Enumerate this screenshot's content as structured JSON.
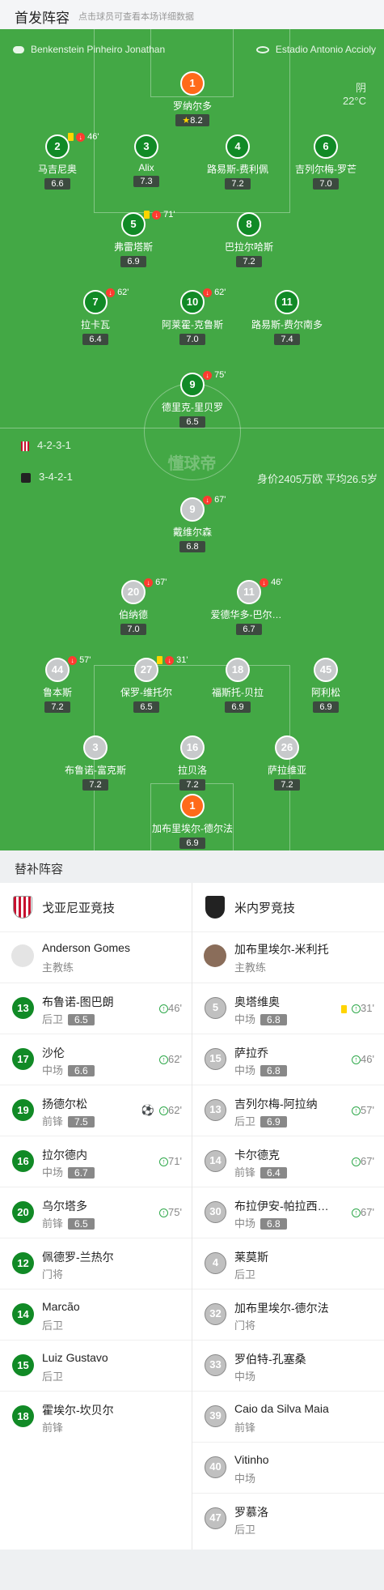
{
  "header": {
    "title": "首发阵容",
    "hint": "点击球员可查看本场详细数据"
  },
  "match": {
    "referee": "Benkenstein Pinheiro Jonathan",
    "stadium": "Estadio Antonio Accioly",
    "weather": "阴",
    "temperature": "22°C",
    "watermark": "懂球帝"
  },
  "home": {
    "team": "戈亚尼亚竞技",
    "formation": "4-2-3-1",
    "coach": "Anderson Gomes",
    "coach_role": "主教练",
    "starters": {
      "gk": {
        "num": "1",
        "name": "罗纳尔多",
        "rating": "8.2"
      },
      "d1": {
        "num": "2",
        "name": "马吉尼奥",
        "rating": "6.6",
        "event": "46'"
      },
      "d2": {
        "num": "3",
        "name": "Alix",
        "rating": "7.3"
      },
      "d3": {
        "num": "4",
        "name": "路易斯-费利佩",
        "rating": "7.2"
      },
      "d4": {
        "num": "6",
        "name": "吉列尔梅-罗芒",
        "rating": "7.0"
      },
      "m1": {
        "num": "5",
        "name": "弗雷塔斯",
        "rating": "6.9",
        "event": "71'"
      },
      "m2": {
        "num": "8",
        "name": "巴拉尔哈斯",
        "rating": "7.2"
      },
      "am1": {
        "num": "7",
        "name": "拉卡瓦",
        "rating": "6.4",
        "event": "62'"
      },
      "am2": {
        "num": "10",
        "name": "阿莱霍-克鲁斯",
        "rating": "7.0",
        "event": "62'"
      },
      "am3": {
        "num": "11",
        "name": "路易斯-费尔南多",
        "rating": "7.4"
      },
      "st": {
        "num": "9",
        "name": "德里克-里贝罗",
        "rating": "6.5",
        "event": "75'"
      }
    }
  },
  "away": {
    "team": "米内罗竞技",
    "formation": "3-4-2-1",
    "market_value": "身价2405万欧 平均26.5岁",
    "coach": "加布里埃尔-米利托",
    "coach_role": "主教练",
    "starters": {
      "st": {
        "num": "9",
        "name": "戴维尔森",
        "rating": "6.8",
        "event": "67'"
      },
      "am1": {
        "num": "20",
        "name": "伯纳德",
        "rating": "7.0",
        "event": "67'"
      },
      "am2": {
        "num": "11",
        "name": "爱德华多-巴尔加斯",
        "rating": "6.7",
        "event": "46'"
      },
      "m1": {
        "num": "44",
        "name": "鲁本斯",
        "rating": "7.2",
        "event": "57'"
      },
      "m2": {
        "num": "27",
        "name": "保罗-维托尔",
        "rating": "6.5",
        "event": "31'"
      },
      "m3": {
        "num": "18",
        "name": "福斯托-贝拉",
        "rating": "6.9"
      },
      "m4": {
        "num": "45",
        "name": "阿利松",
        "rating": "6.9"
      },
      "d1": {
        "num": "3",
        "name": "布鲁诺-富克斯",
        "rating": "7.2"
      },
      "d2": {
        "num": "16",
        "name": "拉贝洛",
        "rating": "7.2"
      },
      "d3": {
        "num": "26",
        "name": "萨拉维亚",
        "rating": "7.2"
      },
      "gk": {
        "num": "1",
        "name": "加布里埃尔-德尔法",
        "rating": "6.9"
      }
    }
  },
  "subs_title": "替补阵容",
  "home_subs": [
    {
      "num": "13",
      "name": "布鲁诺-图巴朗",
      "pos": "后卫",
      "rating": "6.5",
      "sub": "46'"
    },
    {
      "num": "17",
      "name": "沙伦",
      "pos": "中场",
      "rating": "6.6",
      "sub": "62'"
    },
    {
      "num": "19",
      "name": "扬德尔松",
      "pos": "前锋",
      "rating": "7.5",
      "sub": "62'",
      "goal": "⚽"
    },
    {
      "num": "16",
      "name": "拉尔德内",
      "pos": "中场",
      "rating": "6.7",
      "sub": "71'"
    },
    {
      "num": "20",
      "name": "乌尔塔多",
      "pos": "前锋",
      "rating": "6.5",
      "sub": "75'"
    },
    {
      "num": "12",
      "name": "佩德罗-兰热尔",
      "pos": "门将"
    },
    {
      "num": "14",
      "name": "Marcão",
      "pos": "后卫"
    },
    {
      "num": "15",
      "name": "Luiz Gustavo",
      "pos": "后卫"
    },
    {
      "num": "18",
      "name": "霍埃尔-坎贝尔",
      "pos": "前锋"
    }
  ],
  "away_subs": [
    {
      "num": "5",
      "name": "奥塔维奥",
      "pos": "中场",
      "rating": "6.8",
      "sub": "31'",
      "card": "yellow"
    },
    {
      "num": "15",
      "name": "萨拉乔",
      "pos": "中场",
      "rating": "6.8",
      "sub": "46'"
    },
    {
      "num": "13",
      "name": "吉列尔梅-阿拉纳",
      "pos": "后卫",
      "rating": "6.9",
      "sub": "57'"
    },
    {
      "num": "14",
      "name": "卡尔德克",
      "pos": "前锋",
      "rating": "6.4",
      "sub": "67'"
    },
    {
      "num": "30",
      "name": "布拉伊安-帕拉西奥斯",
      "pos": "中场",
      "rating": "6.8",
      "sub": "67'"
    },
    {
      "num": "4",
      "name": "莱莫斯",
      "pos": "后卫"
    },
    {
      "num": "32",
      "name": "加布里埃尔-德尔法",
      "pos": "门将"
    },
    {
      "num": "33",
      "name": "罗伯特-孔塞桑",
      "pos": "中场"
    },
    {
      "num": "39",
      "name": "Caio da Silva Maia",
      "pos": "前锋"
    },
    {
      "num": "40",
      "name": "Vitinho",
      "pos": "中场"
    },
    {
      "num": "47",
      "name": "罗慕洛",
      "pos": "后卫"
    }
  ],
  "colors": {
    "pitch": "#43a845",
    "home": "#118a26",
    "gk": "#ff6a1a",
    "away": "#c7c9cb"
  }
}
